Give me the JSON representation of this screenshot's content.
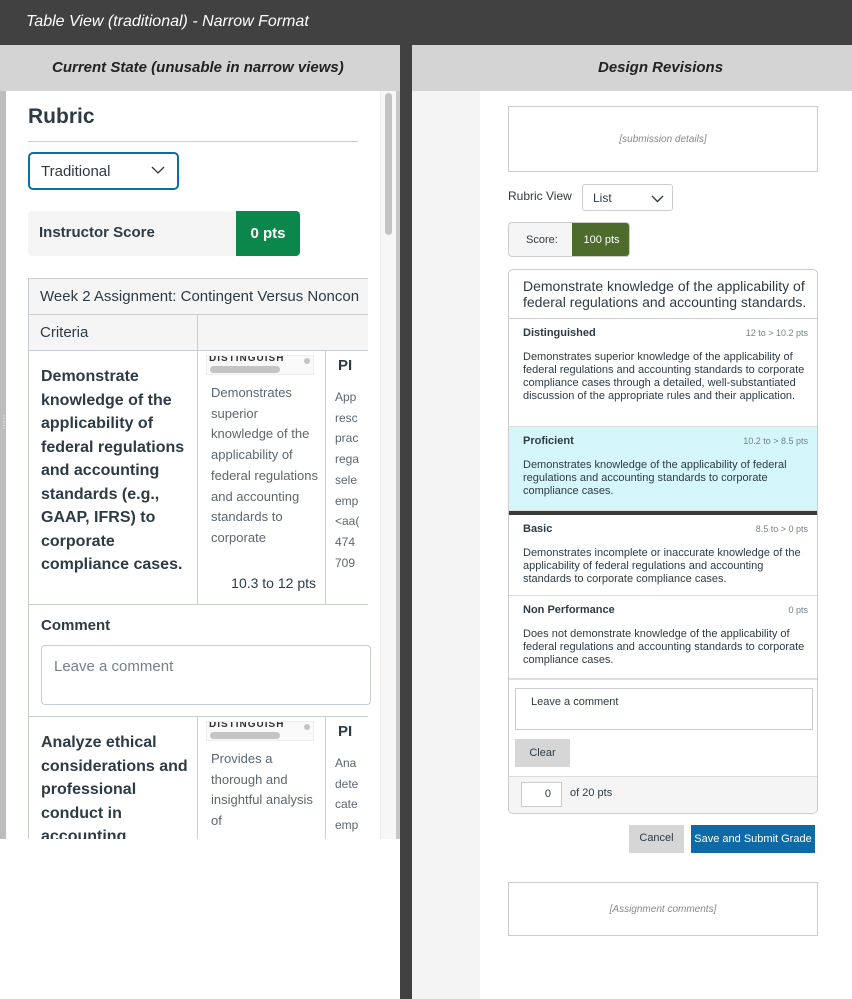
{
  "window": {
    "title": "Table View (traditional) - Narrow Format"
  },
  "left_panel": {
    "header": "Current State (unusable in narrow views)",
    "rubric_title": "Rubric",
    "view_select": {
      "value": "Traditional"
    },
    "instructor_score": {
      "label": "Instructor Score",
      "value": "0 pts"
    },
    "table": {
      "caption": "Week 2 Assignment: Contingent Versus Noncon",
      "column_header": "Criteria",
      "rows": [
        {
          "criterion": "Demonstrate knowledge of the applicability of federal regulations and accounting standards (e.g., GAAP, IFRS) to corporate compliance cases.",
          "rating_header_clipped": "DISTINGUISH",
          "rating_desc": "Demonstrates superior knowledge of the applicability of federal regulations and accounting standards to corporate",
          "rating_points": "10.3 to 12 pts",
          "next_header_clipped": "PI",
          "next_desc_lines": [
            "App",
            "resc",
            "prac",
            "rega",
            "sele",
            "emp",
            "<aa(",
            "474",
            "709"
          ]
        },
        {
          "criterion": "Analyze ethical considerations and professional conduct in accounting decision",
          "rating_header_clipped": "DISTINGUISH",
          "rating_desc": "Provides a thorough and insightful analysis of",
          "next_header_clipped": "PI",
          "next_desc_lines": [
            "Ana",
            "dete",
            "cate",
            "emp"
          ]
        }
      ],
      "comment": {
        "label": "Comment",
        "placeholder": "Leave a comment"
      }
    }
  },
  "right_panel": {
    "header": "Design Revisions",
    "submission_details": "[submission details]",
    "rubric_view": {
      "label": "Rubric View",
      "value": "List"
    },
    "score": {
      "label": "Score:",
      "value": "100 pts"
    },
    "criterion": {
      "title": "Demonstrate knowledge of the applicability of federal regulations and accounting standards.",
      "ratings": [
        {
          "name": "Distinguished",
          "range": "12 to > 10.2 pts",
          "desc": "Demonstrates superior knowledge of the applicability of federal regulations and accounting standards to corporate compliance cases through a detailed, well-substantiated discussion of the appropriate rules and their application.",
          "selected": false
        },
        {
          "name": "Proficient",
          "range": "10.2 to > 8.5 pts",
          "desc": "Demonstrates knowledge of the applicability of federal regulations and accounting standards to corporate compliance cases.",
          "selected": true
        },
        {
          "name": "Basic",
          "range": "8.5 to > 0 pts",
          "desc": "Demonstrates incomplete or inaccurate knowledge of the applicability of federal regulations and accounting standards to corporate compliance cases.",
          "selected": false
        },
        {
          "name": "Non Performance",
          "range": "0 pts",
          "desc": "Does not demonstrate knowledge of the applicability of federal regulations and accounting standards to corporate compliance cases.",
          "selected": false
        }
      ],
      "comment_placeholder": "Leave a comment",
      "clear_label": "Clear",
      "points_value": "0",
      "points_of": "of 20 pts"
    },
    "cancel_label": "Cancel",
    "submit_label": "Save and Submit Grade",
    "assignment_comments": "[Assignment comments]",
    "colors": {
      "selected_bg": "#d5f6fa",
      "score_green": "#4d6b2b",
      "primary_blue": "#0e6aa7",
      "instructor_green": "#0b874b"
    }
  }
}
